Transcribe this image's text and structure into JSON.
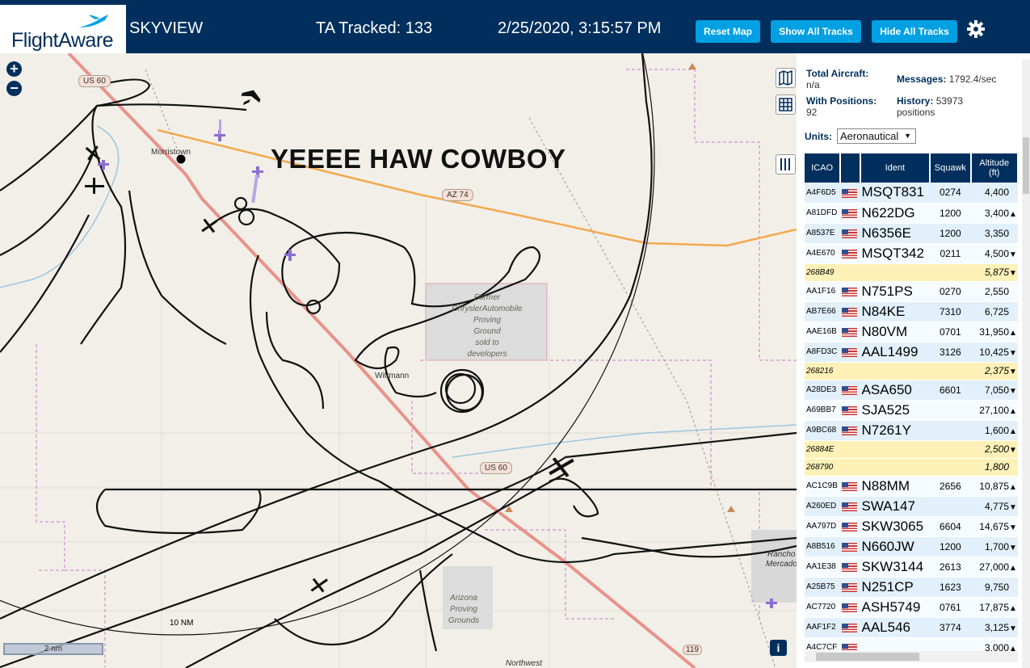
{
  "header": {
    "logo_text": "FlightAware",
    "app_title": "SKYVIEW",
    "ta_tracked": "TA Tracked: 133",
    "clock": "2/25/2020, 3:15:57 PM",
    "buttons": {
      "reset": "Reset Map",
      "show_all": "Show All Tracks",
      "hide_all": "Hide All Tracks"
    },
    "accent_color": "#00a0e2",
    "brand_color": "#002f5d"
  },
  "map": {
    "overlay_text": "YEEEE HAW COWBOY",
    "places": {
      "morristown": "Morristown",
      "wittmann": "Wittmann",
      "rancho": "Rancho",
      "mercado": "Mercado",
      "northwest": "Northwest"
    },
    "roads": {
      "us60_a": "US 60",
      "us60_b": "US 60",
      "az74": "AZ 74",
      "r119": "119"
    },
    "areas": {
      "proving1": [
        "Former",
        "ChryslerAutomobile",
        "Proving",
        "Ground",
        "sold to",
        "developers"
      ],
      "proving2": [
        "Arizona",
        "Proving",
        "Grounds"
      ]
    },
    "range_label": "10 NM",
    "scale_label": "2 nm",
    "zoom_in": "+",
    "zoom_out": "−",
    "info": "i"
  },
  "stats": {
    "total_label": "Total Aircraft:",
    "total_value": "n/a",
    "messages_label": "Messages:",
    "messages_value": "1792.4/sec",
    "positions_label": "With Positions:",
    "positions_value": "92",
    "history_label": "History:",
    "history_value": "53973",
    "history_unit": "positions"
  },
  "units": {
    "label": "Units:",
    "selected": "Aeronautical"
  },
  "table": {
    "headers": {
      "icao": "ICAO",
      "ident": "Ident",
      "squawk": "Squawk",
      "alt": "Altitude",
      "alt_unit": "(ft)"
    },
    "rows": [
      {
        "icao": "A4F6D5",
        "ident": "MSQT831",
        "squawk": "0274",
        "alt": "4,400",
        "trend": "",
        "flag": true
      },
      {
        "icao": "A81DFD",
        "ident": "N622DG",
        "squawk": "1200",
        "alt": "3,400",
        "trend": "▲",
        "flag": true
      },
      {
        "icao": "A8537E",
        "ident": "N6356E",
        "squawk": "1200",
        "alt": "3,350",
        "trend": "",
        "flag": true
      },
      {
        "icao": "A4E670",
        "ident": "MSQT342",
        "squawk": "0211",
        "alt": "4,500",
        "trend": "▼",
        "flag": true
      },
      {
        "icao": "268B49",
        "ident": "",
        "squawk": "",
        "alt": "5,875",
        "trend": "▼",
        "flag": false
      },
      {
        "icao": "AA1F16",
        "ident": "N751PS",
        "squawk": "0270",
        "alt": "2,550",
        "trend": "",
        "flag": true
      },
      {
        "icao": "AB7E66",
        "ident": "N84KE",
        "squawk": "7310",
        "alt": "6,725",
        "trend": "",
        "flag": true
      },
      {
        "icao": "AAE16B",
        "ident": "N80VM",
        "squawk": "0701",
        "alt": "31,950",
        "trend": "▲",
        "flag": true
      },
      {
        "icao": "A8FD3C",
        "ident": "AAL1499",
        "squawk": "3126",
        "alt": "10,425",
        "trend": "▼",
        "flag": true
      },
      {
        "icao": "268216",
        "ident": "",
        "squawk": "",
        "alt": "2,375",
        "trend": "▼",
        "flag": false
      },
      {
        "icao": "A28DE3",
        "ident": "ASA650",
        "squawk": "6601",
        "alt": "7,050",
        "trend": "▼",
        "flag": true
      },
      {
        "icao": "A69BB7",
        "ident": "SJA525",
        "squawk": "",
        "alt": "27,100",
        "trend": "▲",
        "flag": true
      },
      {
        "icao": "A9BC68",
        "ident": "N7261Y",
        "squawk": "",
        "alt": "1,600",
        "trend": "▲",
        "flag": true
      },
      {
        "icao": "26884E",
        "ident": "",
        "squawk": "",
        "alt": "2,500",
        "trend": "▼",
        "flag": false
      },
      {
        "icao": "268790",
        "ident": "",
        "squawk": "",
        "alt": "1,800",
        "trend": "",
        "flag": false
      },
      {
        "icao": "AC1C9B",
        "ident": "N88MM",
        "squawk": "2656",
        "alt": "10,875",
        "trend": "▲",
        "flag": true
      },
      {
        "icao": "A260ED",
        "ident": "SWA147",
        "squawk": "",
        "alt": "4,775",
        "trend": "▼",
        "flag": true
      },
      {
        "icao": "AA797D",
        "ident": "SKW3065",
        "squawk": "6604",
        "alt": "14,675",
        "trend": "▼",
        "flag": true
      },
      {
        "icao": "A8B516",
        "ident": "N660JW",
        "squawk": "1200",
        "alt": "1,700",
        "trend": "▼",
        "flag": true
      },
      {
        "icao": "AA1E38",
        "ident": "SKW3144",
        "squawk": "2613",
        "alt": "27,000",
        "trend": "▲",
        "flag": true
      },
      {
        "icao": "A25B75",
        "ident": "N251CP",
        "squawk": "1623",
        "alt": "9,750",
        "trend": "",
        "flag": true
      },
      {
        "icao": "AC7720",
        "ident": "ASH5749",
        "squawk": "0761",
        "alt": "17,875",
        "trend": "▲",
        "flag": true
      },
      {
        "icao": "AAF1F2",
        "ident": "AAL546",
        "squawk": "3774",
        "alt": "3,125",
        "trend": "▼",
        "flag": true
      },
      {
        "icao": "A4C7CF",
        "ident": "",
        "squawk": "",
        "alt": "3,000",
        "trend": "▲",
        "flag": true
      }
    ]
  }
}
